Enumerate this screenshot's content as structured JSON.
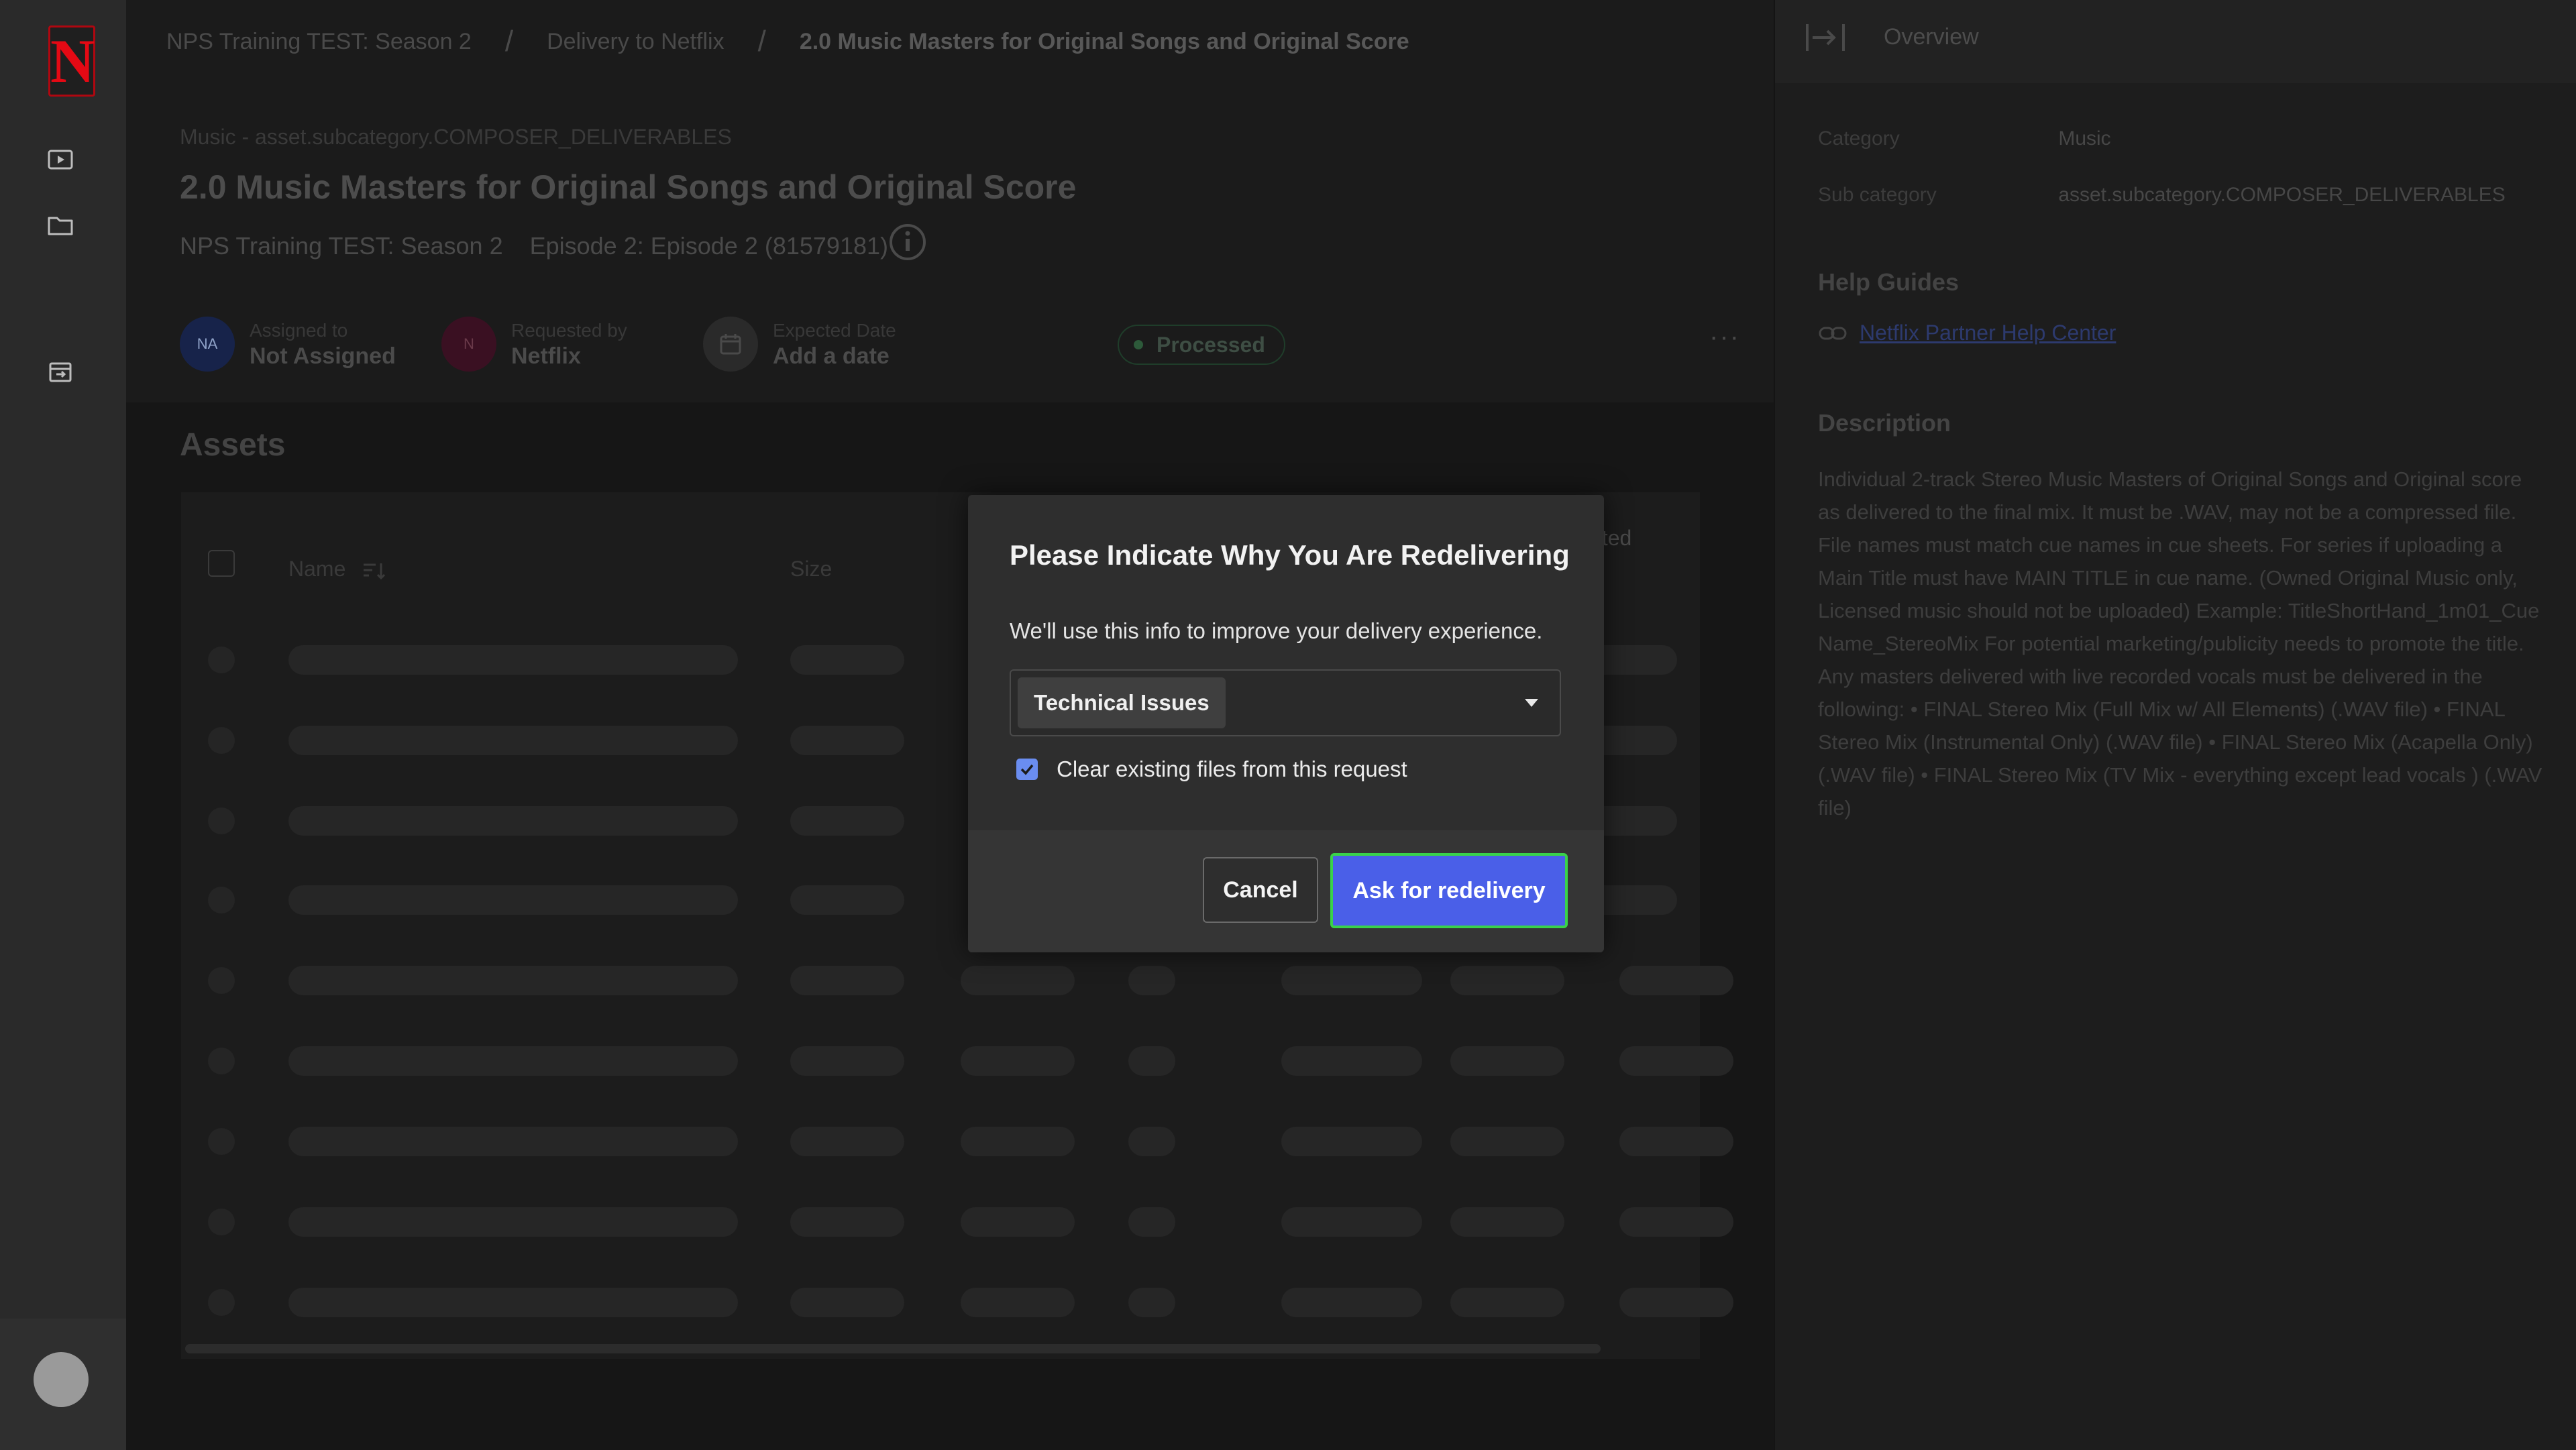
{
  "sidebar": {
    "logo_letter": "N",
    "icons": [
      "play-square-icon",
      "folder-icon",
      "delivery-box-icon"
    ]
  },
  "breadcrumb": {
    "items": [
      "NPS Training TEST: Season 2",
      "Delivery to Netflix",
      "2.0 Music Masters for Original Songs and Original Score"
    ],
    "separator": "/"
  },
  "header": {
    "category_line": "Music - asset.subcategory.COMPOSER_DELIVERABLES",
    "title": "2.0 Music Masters for Original Songs and Original Score",
    "show": "NPS Training TEST: Season 2",
    "episode": "Episode 2: Episode 2 (81579181)"
  },
  "people": {
    "assigned": {
      "initials": "NA",
      "label": "Assigned to",
      "value": "Not Assigned"
    },
    "requested": {
      "initials": "N",
      "label": "Requested by",
      "value": "Netflix"
    },
    "expected": {
      "label": "Expected Date",
      "value": "Add a date"
    },
    "status": "Processed",
    "more": "···"
  },
  "assets": {
    "title": "Assets",
    "columns": [
      "Name",
      "Size"
    ],
    "updated_fragment": "ated"
  },
  "right_panel": {
    "tab": "Overview",
    "category_label": "Category",
    "category_value": "Music",
    "subcategory_label": "Sub category",
    "subcategory_value": "asset.subcategory.COMPOSER_DELIVERABLES",
    "help_title": "Help Guides",
    "help_link": "Netflix Partner Help Center",
    "description_title": "Description",
    "description": "Individual 2-track Stereo Music Masters of Original Songs and Original score as delivered to the final mix. It must be .WAV, may not be a compressed file. File names must match cue names in cue sheets. For series if uploading a Main Title must have MAIN TITLE in cue name. (Owned Original Music only, Licensed music should not be uploaded) Example: TitleShortHand_1m01_Cue Name_StereoMix For potential marketing/publicity needs to promote the title. Any masters delivered with live recorded vocals must be delivered in the following: • FINAL Stereo Mix (Full Mix w/ All Elements) (.WAV file) • FINAL Stereo Mix (Instrumental Only) (.WAV file) • FINAL Stereo Mix (Acapella Only) (.WAV file) • FINAL Stereo Mix (TV Mix - everything except lead vocals ) (.WAV file)"
  },
  "modal": {
    "title": "Please Indicate Why You Are Redelivering",
    "subtitle": "We'll use this info to improve your delivery experience.",
    "selected_reason": "Technical Issues",
    "checkbox_label": "Clear existing files from this request",
    "checkbox_checked": true,
    "cancel_label": "Cancel",
    "confirm_label": "Ask for redelivery"
  },
  "colors": {
    "accent": "#4a5fe8",
    "focus_ring": "#39d24a",
    "brand": "#e50914"
  }
}
